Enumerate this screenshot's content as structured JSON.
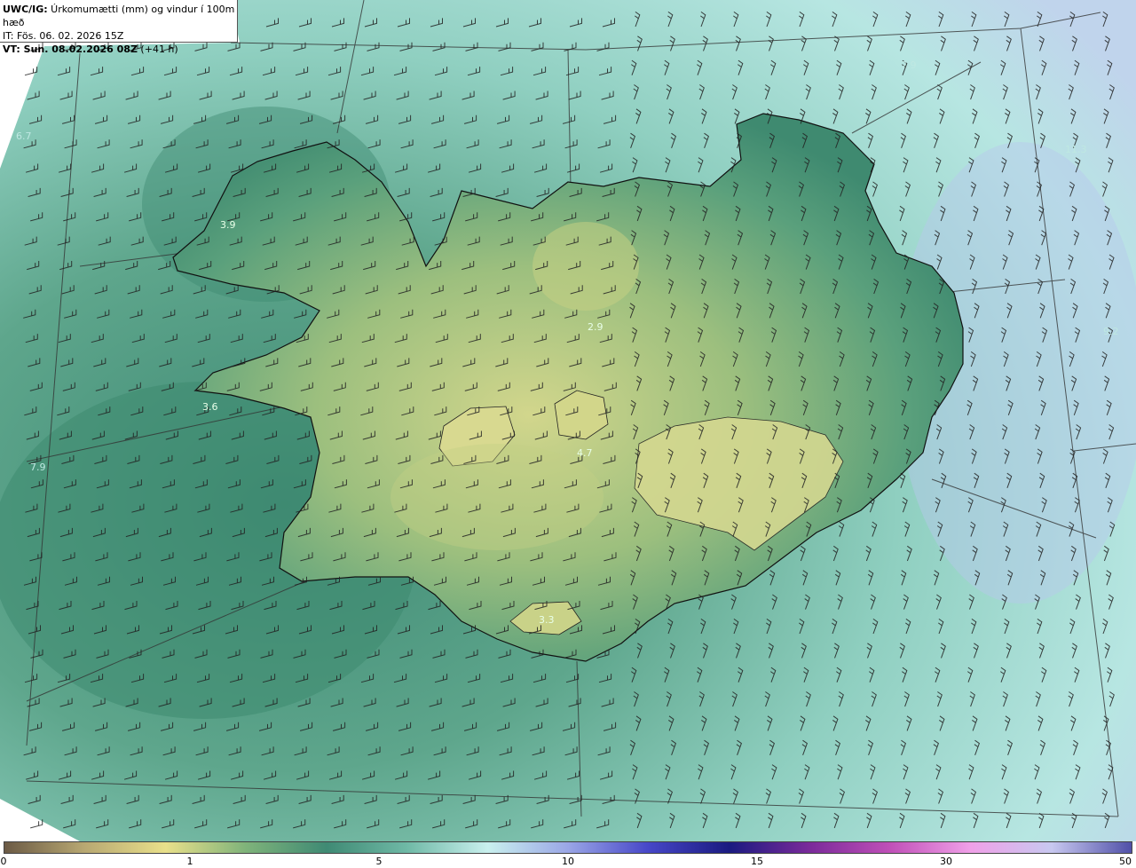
{
  "header": {
    "title_bold": "UWC/IG:",
    "title_rest": " Úrkomumætti (mm) og vindur í 100m hæð",
    "it_line": "IT: Fös. 06. 02. 2026 15Z",
    "vt_bold": "VT: Sun. 08.02.2026 08Z",
    "vt_rest": " (+41 h)"
  },
  "colors": {
    "sea_dark": "#3f8a74",
    "sea_mid": "#6fb9a6",
    "sea_light": "#a6dcd6",
    "sea_pale": "#c8ecec",
    "land_green": "#4e9a78",
    "land_yellow": "#cfd58a",
    "coastline": "#111111",
    "barb": "#222222"
  },
  "colorbar": {
    "ticks": [
      "0",
      "1",
      "5",
      "10",
      "15",
      "30",
      "50"
    ],
    "colors": [
      "#6b5a45",
      "#b8a872",
      "#e9e08a",
      "#7fb37a",
      "#3f8a74",
      "#6fb9a6",
      "#c9f0ee",
      "#9aa6e6",
      "#4747c8",
      "#1a1a80",
      "#7a2a9a",
      "#c050b8",
      "#f0a0e8",
      "#c8c8f0",
      "#5050a8"
    ]
  },
  "map_labels": [
    {
      "text": "3.9"
    },
    {
      "text": "3.6"
    },
    {
      "text": "2.9"
    },
    {
      "text": "4.7"
    },
    {
      "text": "3.3"
    },
    {
      "text": "6.7"
    },
    {
      "text": "7.9"
    },
    {
      "text": "11.3"
    },
    {
      "text": "9.2"
    },
    {
      "text": "7.9"
    }
  ]
}
